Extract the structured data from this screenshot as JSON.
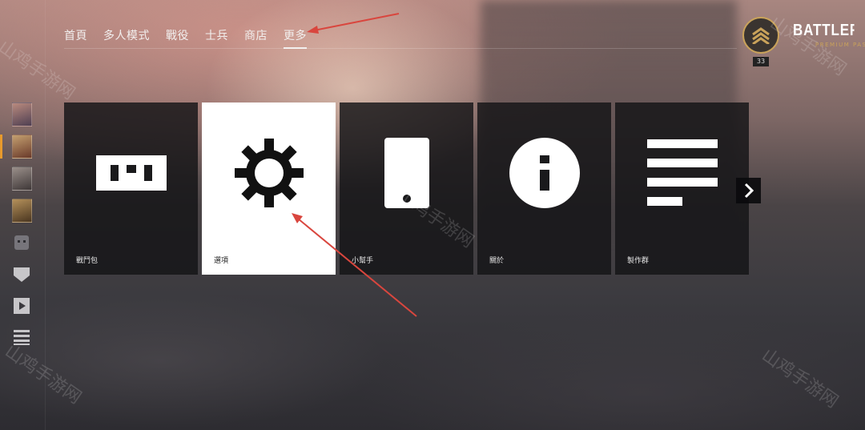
{
  "nav": {
    "items": [
      "首頁",
      "多人模式",
      "戰役",
      "士兵",
      "商店",
      "更多"
    ],
    "active_index": 5
  },
  "profile": {
    "rank_number": "33",
    "logo_text": "BATTLEFIELD",
    "logo_sub": "PREMIUM PASS",
    "accent_color": "#c9a25a"
  },
  "cards": [
    {
      "label": "戰鬥包",
      "icon": "battlepack-icon",
      "selected": false
    },
    {
      "label": "選項",
      "icon": "gear-icon",
      "selected": true
    },
    {
      "label": "小幫手",
      "icon": "phone-icon",
      "selected": false
    },
    {
      "label": "關於",
      "icon": "info-icon",
      "selected": false
    },
    {
      "label": "製作群",
      "icon": "text-lines-icon",
      "selected": false
    }
  ],
  "sidebar": {
    "icons": [
      "face-icon",
      "shield-icon",
      "play-icon",
      "list-icon"
    ]
  },
  "watermark": "山鸡手游网",
  "annotation_color": "#d9463e"
}
